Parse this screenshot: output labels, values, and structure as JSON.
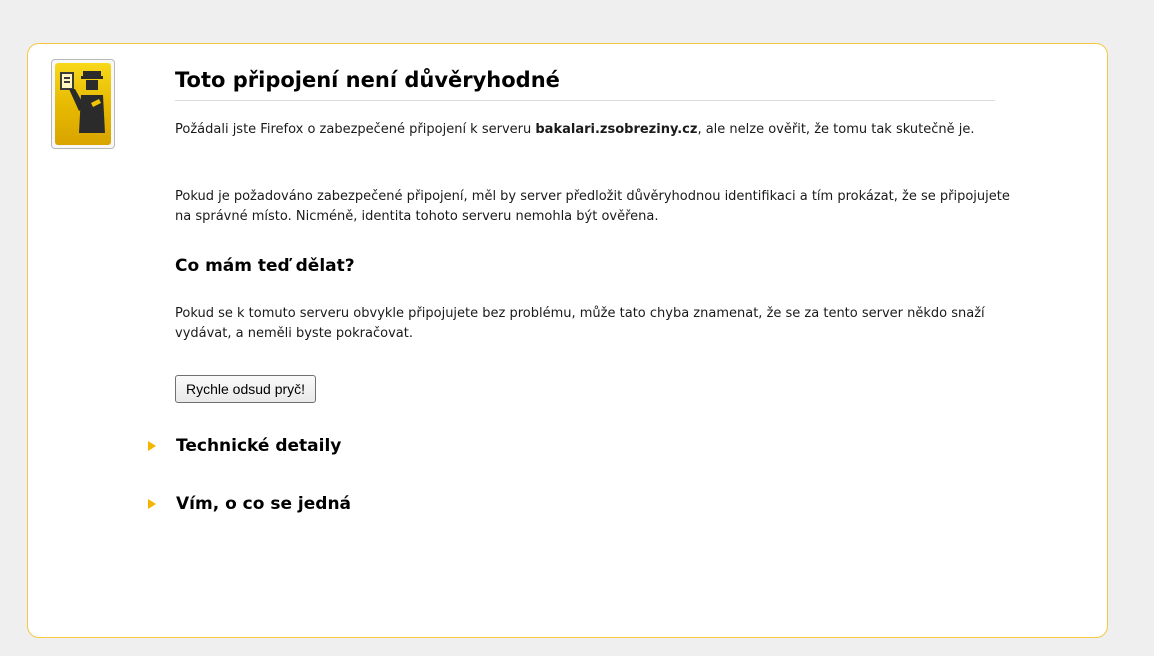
{
  "page": {
    "title": "Toto připojení není důvěryhodné",
    "intro_before": "Požádali jste Firefox o zabezpečené připojení k serveru ",
    "host": "bakalari.zsobreziny.cz",
    "intro_after": ", ale nelze ověřit, že tomu tak skutečně je.",
    "explanation": "Pokud je požadováno zabezpečené připojení, měl by server předložit důvěryhodnou identifikaci a tím prokázat, že se připojujete na správné místo. Nicméně, identita tohoto serveru nemohla být ověřena.",
    "what_to_do_heading": "Co mám teď dělat?",
    "what_to_do_text": "Pokud se k tomuto serveru obvykle připojujete bez problému, může tato chyba znamenat, že se za tento server někdo snaží vydávat, a neměli byste pokračovat.",
    "get_me_out_button": "Rychle odsud pryč!",
    "technical_details_label": "Technické detaily",
    "understand_risks_label": "Vím, o co se jedná"
  },
  "icons": {
    "warning_badge": "officer-badge-icon",
    "expander": "triangle-right-icon"
  },
  "colors": {
    "card_border": "#f5c842",
    "badge_yellow": "#f0c400",
    "expander_arrow": "#f5b400",
    "background": "#efefef"
  }
}
